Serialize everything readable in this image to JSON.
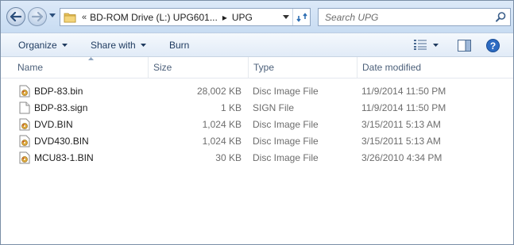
{
  "nav": {
    "breadcrumb": {
      "overflow": "«",
      "drive": "BD-ROM Drive (L:) UPG601...",
      "separator": "▸",
      "folder": "UPG"
    }
  },
  "search": {
    "placeholder": "Search UPG"
  },
  "toolbar": {
    "organize_label": "Organize",
    "share_label": "Share with",
    "burn_label": "Burn"
  },
  "columns": {
    "name": "Name",
    "size": "Size",
    "type": "Type",
    "date": "Date modified"
  },
  "files": [
    {
      "name": "BDP-83.bin",
      "size": "28,002 KB",
      "type": "Disc Image File",
      "date": "11/9/2014 11:50 PM",
      "icon": "disc-image-icon"
    },
    {
      "name": "BDP-83.sign",
      "size": "1 KB",
      "type": "SIGN File",
      "date": "11/9/2014 11:50 PM",
      "icon": "blank-file-icon"
    },
    {
      "name": "DVD.BIN",
      "size": "1,024 KB",
      "type": "Disc Image File",
      "date": "3/15/2011 5:13 AM",
      "icon": "disc-image-icon"
    },
    {
      "name": "DVD430.BIN",
      "size": "1,024 KB",
      "type": "Disc Image File",
      "date": "3/15/2011 5:13 AM",
      "icon": "disc-image-icon"
    },
    {
      "name": "MCU83-1.BIN",
      "size": "30 KB",
      "type": "Disc Image File",
      "date": "3/26/2010 4:34 PM",
      "icon": "disc-image-icon"
    }
  ]
}
